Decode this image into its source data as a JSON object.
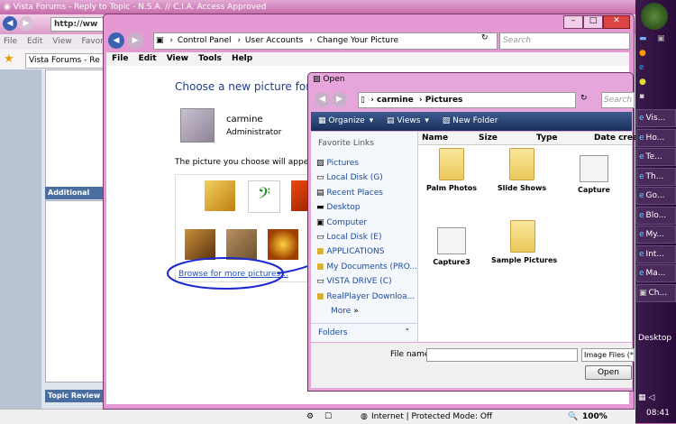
{
  "browser": {
    "title": "Vista Forums - Reply to Topic - N.S.A. // C.I.A. Access Approved",
    "address": "http://ww",
    "menu": [
      "File",
      "Edit",
      "View",
      "Favorit"
    ],
    "tab_label": "Vista Forums - Re",
    "side_panel_1": "Additional Optio",
    "side_panel_2": "Topic Review (N",
    "status_zone": "Internet | Protected Mode: Off",
    "zoom": "100%"
  },
  "control_panel": {
    "breadcrumb": [
      "Control Panel",
      "User Accounts",
      "Change Your Picture"
    ],
    "search_placeholder": "Search",
    "menu": [
      "File",
      "Edit",
      "View",
      "Tools",
      "Help"
    ],
    "heading": "Choose a new picture for you",
    "user_name": "carmine",
    "user_role": "Administrator",
    "description": "The picture you choose will appear on",
    "browse_link": "Browse for more pictures..."
  },
  "open_dialog": {
    "title": "Open",
    "path": [
      "carmine",
      "Pictures"
    ],
    "search_placeholder": "Search",
    "toolbar": {
      "organize": "Organize",
      "views": "Views",
      "new_folder": "New Folder"
    },
    "favorite_links_heading": "Favorite Links",
    "favorite_links": [
      "Pictures",
      "Local Disk (G)",
      "Recent Places",
      "Desktop",
      "Computer",
      "Local Disk (E)",
      "APPLICATIONS",
      "My Documents (PRO...",
      "VISTA DRIVE (C)",
      "RealPlayer Downloa...",
      "More"
    ],
    "folders_label": "Folders",
    "columns": [
      "Name",
      "Size",
      "Type",
      "Date crea"
    ],
    "items": [
      {
        "label": "Palm Photos",
        "icon": "folder-icon"
      },
      {
        "label": "Slide Shows",
        "icon": "folder-icon"
      },
      {
        "label": "Capture",
        "icon": "image-thumb-icon"
      },
      {
        "label": "Capture3",
        "icon": "image-thumb-icon"
      },
      {
        "label": "Sample Pictures",
        "icon": "folder-icon"
      }
    ],
    "file_name_label": "File name:",
    "file_type": "Image Files (*.",
    "open_button": "Open"
  },
  "taskbar": {
    "items": [
      "Vis...",
      "Ho...",
      "Te...",
      "Th...",
      "Go...",
      "Blo...",
      "My...",
      "Int...",
      "Ma...",
      "Ch..."
    ],
    "desktop_label": "Desktop",
    "clock": "08:41"
  }
}
